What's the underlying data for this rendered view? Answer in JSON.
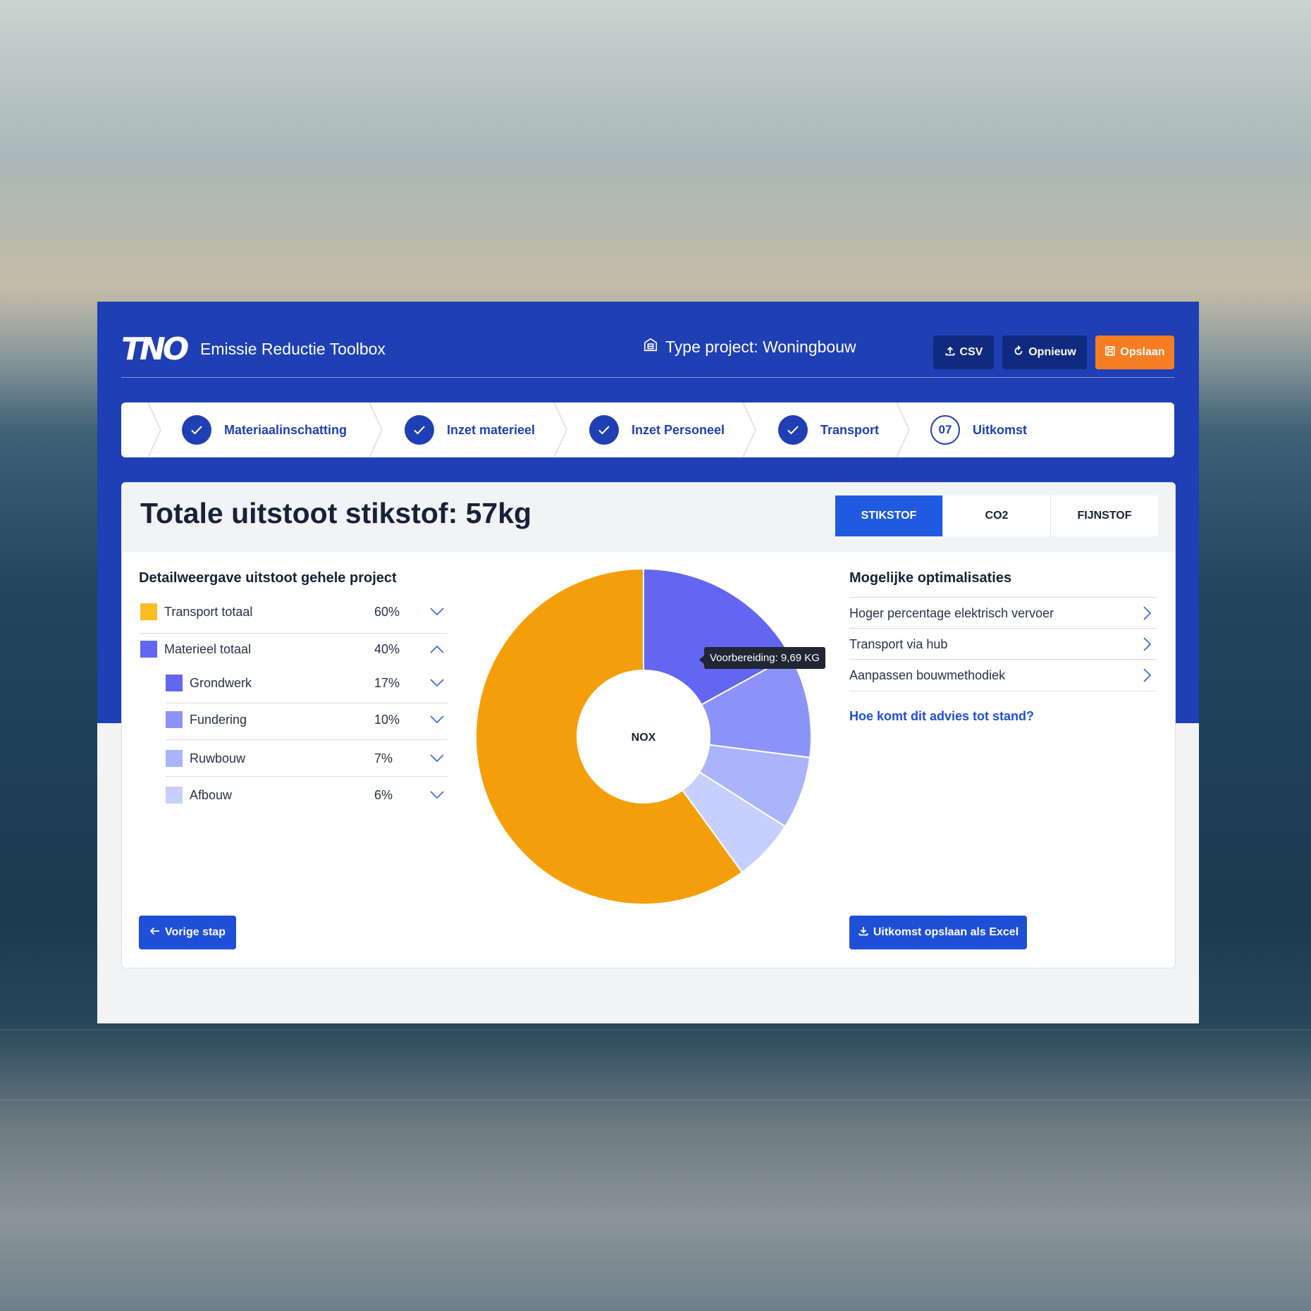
{
  "header": {
    "logo_text": "TNO",
    "app_title": "Emissie Reductie Toolbox",
    "project_type": "Type project: Woningbouw",
    "buttons": {
      "csv": "CSV",
      "restart": "Opnieuw",
      "save": "Opslaan"
    }
  },
  "steps": [
    {
      "label": "Materiaalinschatting",
      "state": "done"
    },
    {
      "label": "Inzet materieel",
      "state": "done"
    },
    {
      "label": "Inzet Personeel",
      "state": "done"
    },
    {
      "label": "Transport",
      "state": "done"
    },
    {
      "label": "Uitkomst",
      "state": "current",
      "number": "07"
    }
  ],
  "result": {
    "title": "Totale uitstoot stikstof: 57kg",
    "tabs": [
      "STIKSTOF",
      "CO2",
      "FIJNSTOF"
    ],
    "active_tab": "STIKSTOF"
  },
  "detail": {
    "title": "Detailweergave uitstoot gehele project",
    "rows": [
      {
        "name": "Transport totaal",
        "pct": "60%",
        "color": "#f8bd24",
        "level": 0,
        "expanded": false
      },
      {
        "name": "Materieel totaal",
        "pct": "40%",
        "color": "#6366f1",
        "level": 0,
        "expanded": true
      },
      {
        "name": "Grondwerk",
        "pct": "17%",
        "color": "#6366f1",
        "level": 1,
        "expanded": false
      },
      {
        "name": "Fundering",
        "pct": "10%",
        "color": "#8b93f8",
        "level": 1,
        "expanded": false
      },
      {
        "name": "Ruwbouw",
        "pct": "7%",
        "color": "#a9b4fb",
        "level": 1,
        "expanded": false
      },
      {
        "name": "Afbouw",
        "pct": "6%",
        "color": "#c7d0fd",
        "level": 1,
        "expanded": false
      }
    ]
  },
  "chart_data": {
    "type": "pie",
    "center_label": "NOX",
    "categories": [
      "Transport totaal",
      "Grondwerk",
      "Fundering",
      "Ruwbouw",
      "Afbouw"
    ],
    "values": [
      60,
      17,
      10,
      7,
      6
    ],
    "colors": [
      "#f59e0b",
      "#6366f1",
      "#8b93f8",
      "#a9b4fb",
      "#c7d0fd"
    ],
    "tooltip": "Voorbereiding: 9,69 KG"
  },
  "optimizations": {
    "title": "Mogelijke optimalisaties",
    "items": [
      "Hoger percentage elektrisch vervoer",
      "Transport via hub",
      "Aanpassen bouwmethodiek"
    ],
    "link": "Hoe komt dit advies tot stand?"
  },
  "footer": {
    "prev": "Vorige stap",
    "excel": "Uitkomst opslaan als Excel"
  }
}
